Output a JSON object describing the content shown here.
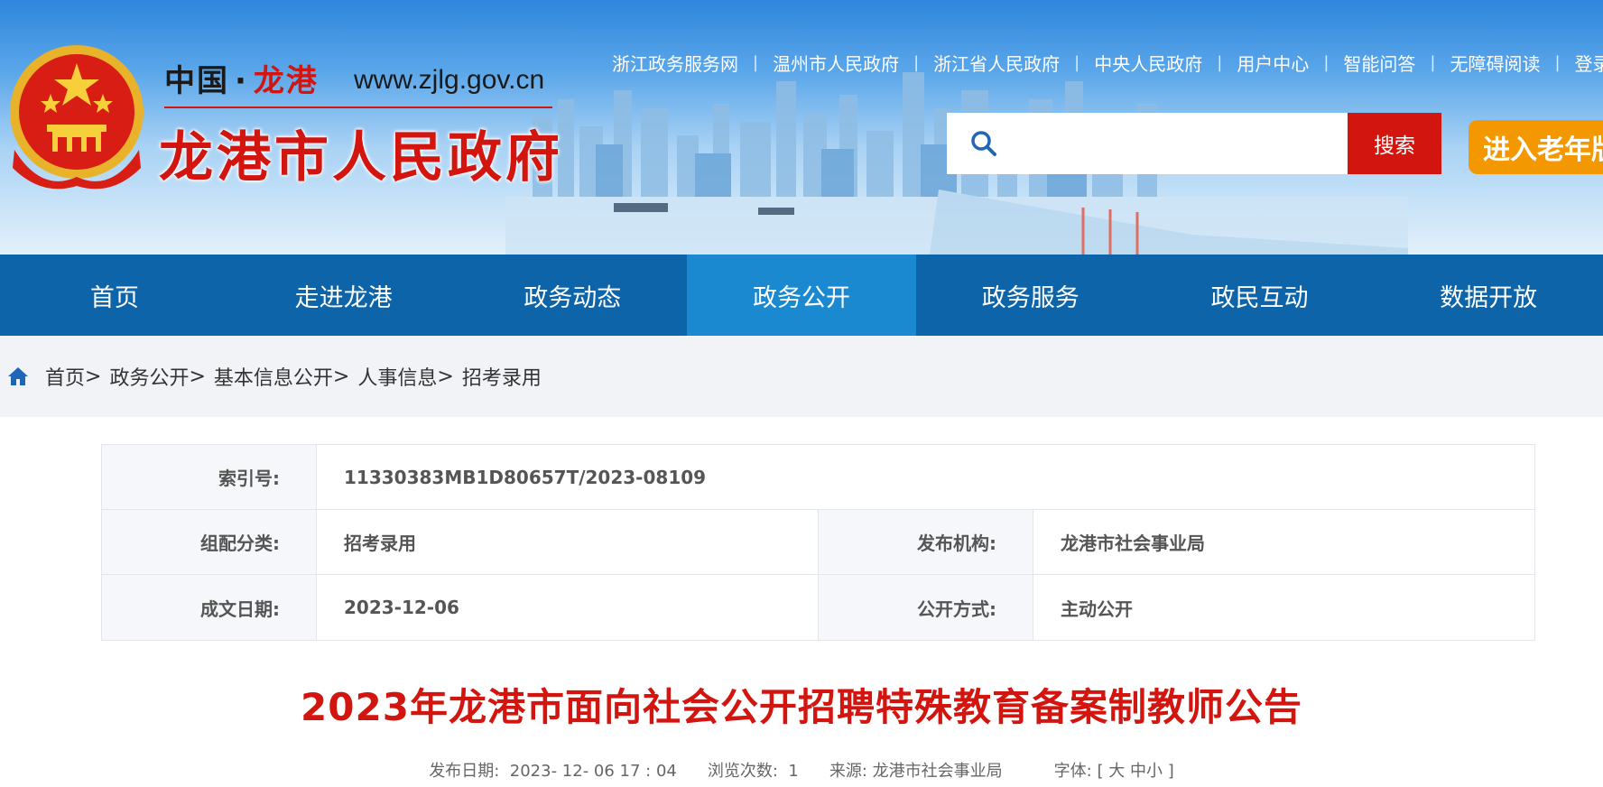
{
  "site": {
    "name_prefix": "中国",
    "name_dot": "·",
    "name_city": "龙港",
    "url": "www.zjlg.gov.cn",
    "title": "龙港市人民政府"
  },
  "toplinks": [
    "浙江政务服务网",
    "温州市人民政府",
    "浙江省人民政府",
    "中央人民政府",
    "用户中心",
    "智能问答",
    "无障碍阅读",
    "登录"
  ],
  "search": {
    "placeholder": "",
    "button": "搜索"
  },
  "elder_mode": "进入老年版",
  "nav": {
    "items": [
      "首页",
      "走进龙港",
      "政务动态",
      "政务公开",
      "政务服务",
      "政民互动",
      "数据开放"
    ],
    "active_index": 3
  },
  "breadcrumb": [
    "首页",
    "政务公开",
    "基本信息公开",
    "人事信息",
    "招考录用"
  ],
  "breadcrumb_sep": ">",
  "info": {
    "index_label": "索引号:",
    "index_value": "11330383MB1D80657T/2023-08109",
    "category_label": "组配分类:",
    "category_value": "招考录用",
    "publisher_label": "发布机构:",
    "publisher_value": "龙港市社会事业局",
    "date_label": "成文日期:",
    "date_value": "2023-12-06",
    "open_label": "公开方式:",
    "open_value": "主动公开"
  },
  "article": {
    "title": "2023年龙港市面向社会公开招聘特殊教育备案制教师公告",
    "publish_label": "发布日期:",
    "publish_value": "2023- 12- 06 17 : 04",
    "views_label": "浏览次数:",
    "views_value": "1",
    "source_label": "来源:",
    "source_value": "龙港市社会事业局",
    "font_label": "字体:",
    "font_open": "[",
    "font_large": "大",
    "font_medium": "中",
    "font_small": "小",
    "font_close": "]"
  },
  "colors": {
    "brand_red": "#d3150f",
    "nav_blue": "#0d64a9",
    "nav_active": "#1a89cf",
    "elder_orange": "#f39800"
  }
}
